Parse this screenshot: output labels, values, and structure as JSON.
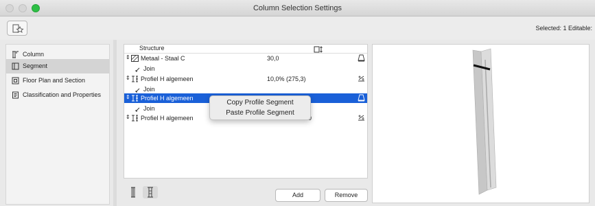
{
  "window": {
    "title": "Column Selection Settings"
  },
  "toolbar": {
    "selected_info": "Selected: 1 Editable:"
  },
  "sidebar": {
    "items": [
      {
        "label": "Column",
        "icon": "column-icon",
        "selected": false
      },
      {
        "label": "Segment",
        "icon": "segment-icon",
        "selected": true
      },
      {
        "label": "Floor Plan and Section",
        "icon": "floor-plan-icon",
        "selected": false
      },
      {
        "label": "Classification and Properties",
        "icon": "classification-icon",
        "selected": false
      }
    ]
  },
  "segments": {
    "headers": {
      "structure": "Structure",
      "size_icon": "height-icon"
    },
    "rows": [
      {
        "type": "segment",
        "name": "Metaal - Staal C",
        "value": "30,0",
        "selected": false
      },
      {
        "type": "join",
        "name": "Join"
      },
      {
        "type": "segment",
        "name": "Profiel H algemeen",
        "value": "10,0% (275,3)",
        "selected": false
      },
      {
        "type": "join",
        "name": "Join"
      },
      {
        "type": "segment",
        "name": "Profiel H algemeen",
        "value": "",
        "selected": true
      },
      {
        "type": "join",
        "name": "Join"
      },
      {
        "type": "segment",
        "name": "Profiel H algemeen",
        "value": "0",
        "selected": false
      }
    ]
  },
  "context_menu": {
    "items": [
      "Copy Profile Segment",
      "Paste Profile Segment"
    ]
  },
  "buttons": {
    "add": "Add",
    "remove": "Remove"
  },
  "colors": {
    "selection": "#1a60d8",
    "zoom_button": "#2dbf45"
  }
}
